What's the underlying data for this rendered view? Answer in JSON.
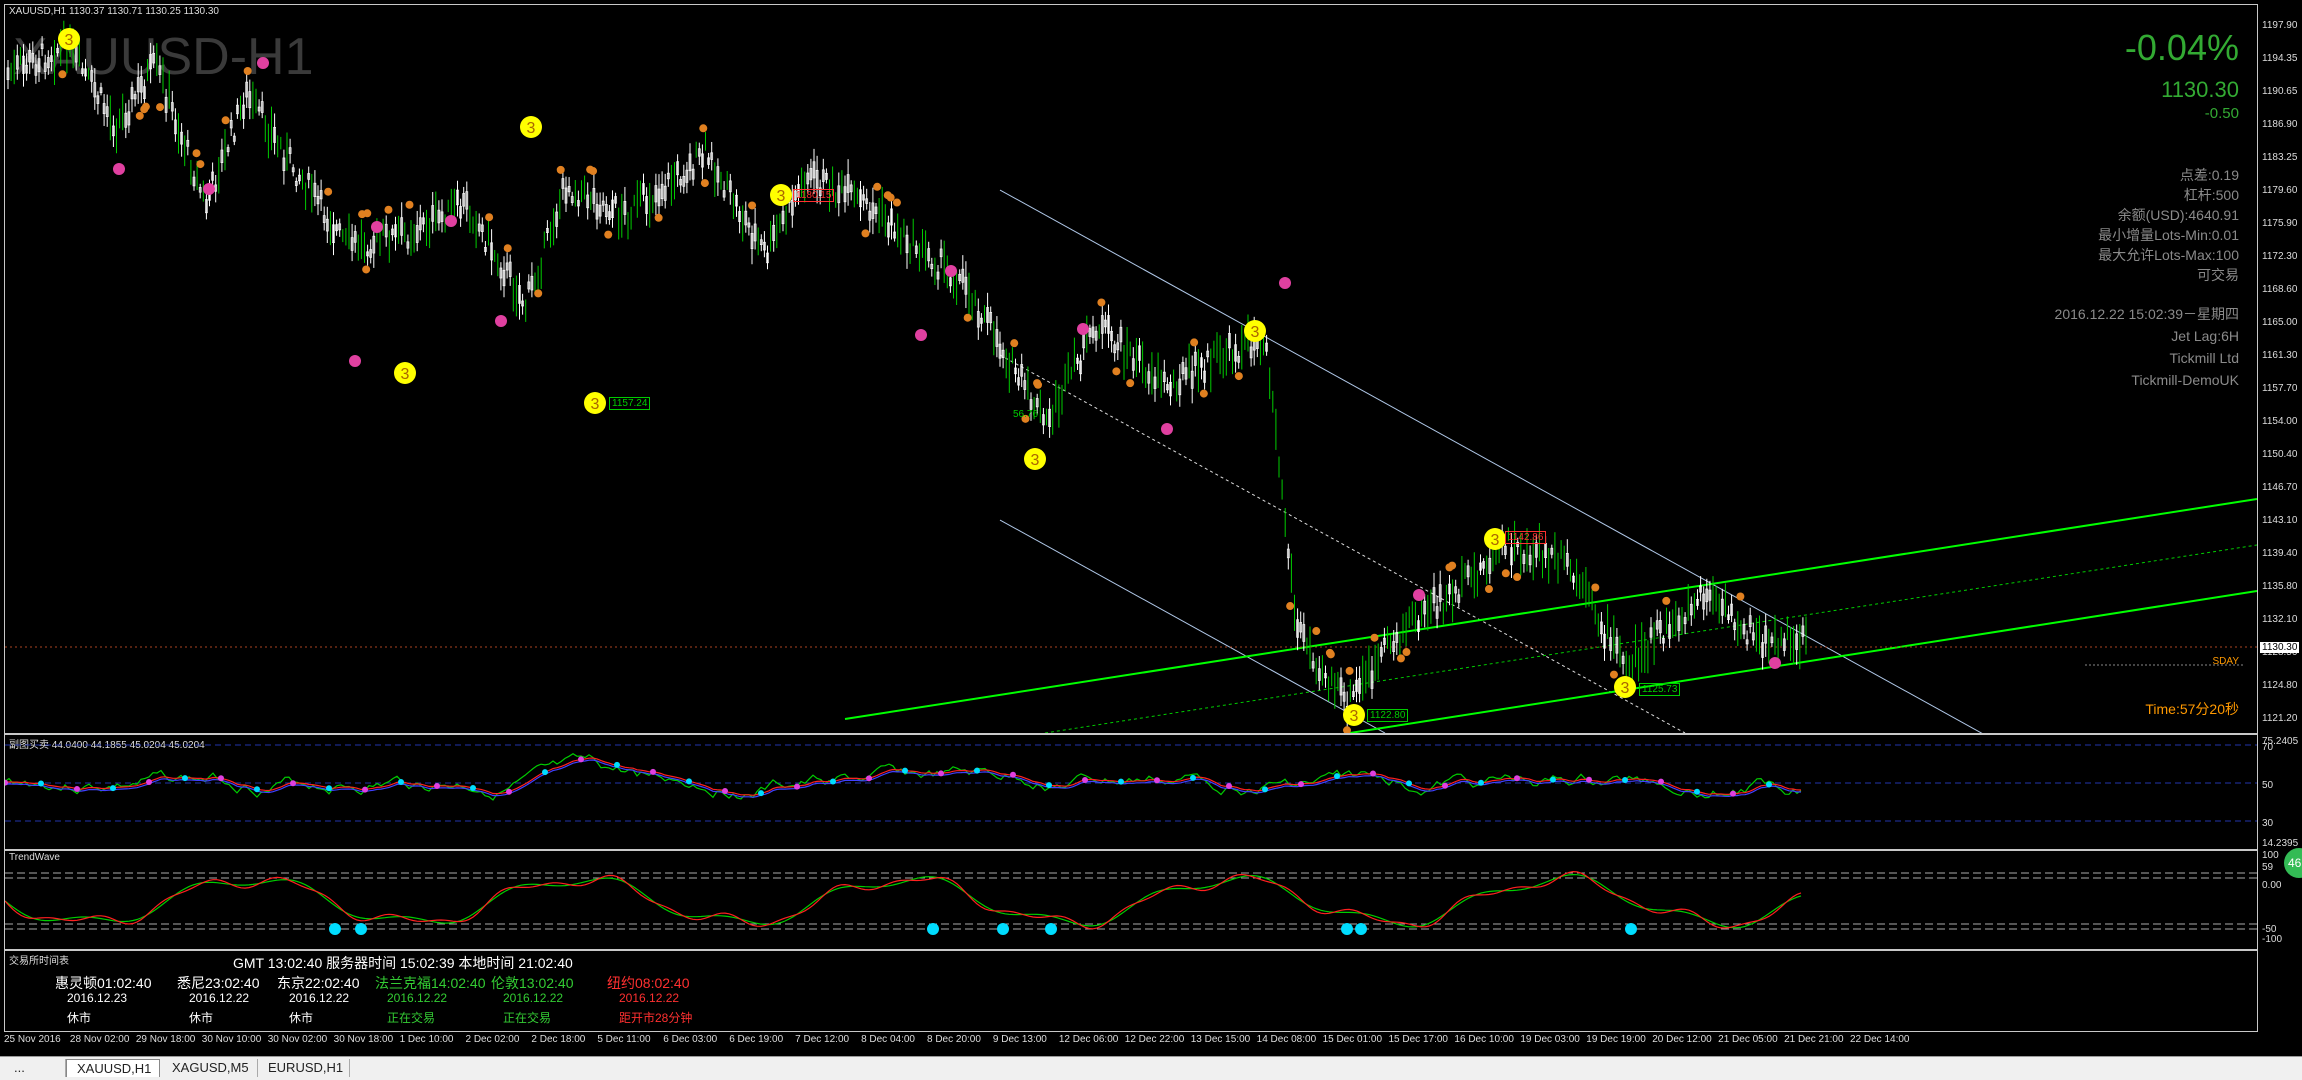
{
  "chart": {
    "header_line": "XAUUSD,H1  1130.37 1130.71 1130.25 1130.30",
    "watermark": "XAUUSD-H1",
    "change_pct": "-0.04%",
    "price": "1130.30",
    "change_abs": "-0.50",
    "info_lines": [
      "点差:0.19",
      "杠杆:500",
      "余额(USD):4640.91",
      "最小增量Lots-Min:0.01",
      "最大允许Lots-Max:100",
      "可交易"
    ],
    "server_info_lines": [
      "2016.12.22 15:02:39－星期四",
      "Jet Lag:6H",
      "Tickmill Ltd",
      "Tickmill-DemoUK"
    ],
    "countdown": "Time:57分20秒",
    "price_tag": "1130.30",
    "sday_label": "SDAY",
    "level_labels": [
      "1180.15",
      "1157.24",
      "1142.86",
      "1125.73",
      "1122.80",
      "56.76"
    ],
    "wave_marker": "3",
    "y_ticks": [
      "1197.90",
      "1194.35",
      "1190.65",
      "1186.90",
      "1183.25",
      "1179.60",
      "1175.90",
      "1172.30",
      "1168.60",
      "1165.00",
      "1161.30",
      "1157.70",
      "1154.00",
      "1150.40",
      "1146.70",
      "1143.10",
      "1139.40",
      "1135.80",
      "1132.10",
      "1128.50",
      "1124.80",
      "1121.20"
    ],
    "x_ticks": [
      "25 Nov 2016",
      "28 Nov 02:00",
      "29 Nov 18:00",
      "30 Nov 10:00",
      "30 Nov 02:00",
      "30 Nov 18:00",
      "1 Dec 10:00",
      "2 Dec 02:00",
      "2 Dec 18:00",
      "5 Dec 11:00",
      "6 Dec 03:00",
      "6 Dec 19:00",
      "7 Dec 12:00",
      "8 Dec 04:00",
      "8 Dec 20:00",
      "9 Dec 13:00",
      "12 Dec 06:00",
      "12 Dec 22:00",
      "13 Dec 15:00",
      "14 Dec 08:00",
      "15 Dec 01:00",
      "15 Dec 17:00",
      "16 Dec 10:00",
      "19 Dec 03:00",
      "19 Dec 19:00",
      "20 Dec 12:00",
      "21 Dec 05:00",
      "21 Dec 21:00",
      "22 Dec 14:00"
    ]
  },
  "osc1": {
    "title": "副图买卖 44.0400 44.1855 45.0204 45.0204",
    "y_ticks": [
      "75.2405",
      "70",
      "50",
      "30",
      "14.2395"
    ]
  },
  "osc2": {
    "title": "TrendWave",
    "y_ticks": [
      "100",
      "59",
      "0.00",
      "-50",
      "-100"
    ],
    "badge": "46"
  },
  "clock": {
    "title": "交易所时间表",
    "header": "GMT 13:02:40  服务器时间 15:02:39  本地时间 21:02:40",
    "cities": [
      {
        "name": "惠灵顿01:02:40",
        "date": "2016.12.23",
        "status": "休市",
        "color": "#ffffff"
      },
      {
        "name": "悉尼23:02:40",
        "date": "2016.12.22",
        "status": "休市",
        "color": "#ffffff"
      },
      {
        "name": "东京22:02:40",
        "date": "2016.12.22",
        "status": "休市",
        "color": "#ffffff"
      },
      {
        "name": "法兰克福14:02:40",
        "date": "2016.12.22",
        "status": "正在交易",
        "color": "#33cc33"
      },
      {
        "name": "伦敦13:02:40",
        "date": "2016.12.22",
        "status": "正在交易",
        "color": "#33cc33"
      },
      {
        "name": "纽约08:02:40",
        "date": "2016.12.22",
        "status": "距开市28分钟",
        "color": "#ff3030"
      }
    ]
  },
  "tabs": [
    "...",
    "XAUUSD,H1",
    "XAGUSD,M5",
    "EURUSD,H1"
  ],
  "colors": {
    "bull": "#00cc00",
    "bear": "#ffffff",
    "accent_green": "#33aa33",
    "channel": "#00ff00",
    "trend_blue": "#b0c8e8",
    "marker_yellow": "#ffff00",
    "marker_magenta": "#e040a0",
    "marker_orange": "#e08020",
    "countdown": "#ff9900"
  }
}
